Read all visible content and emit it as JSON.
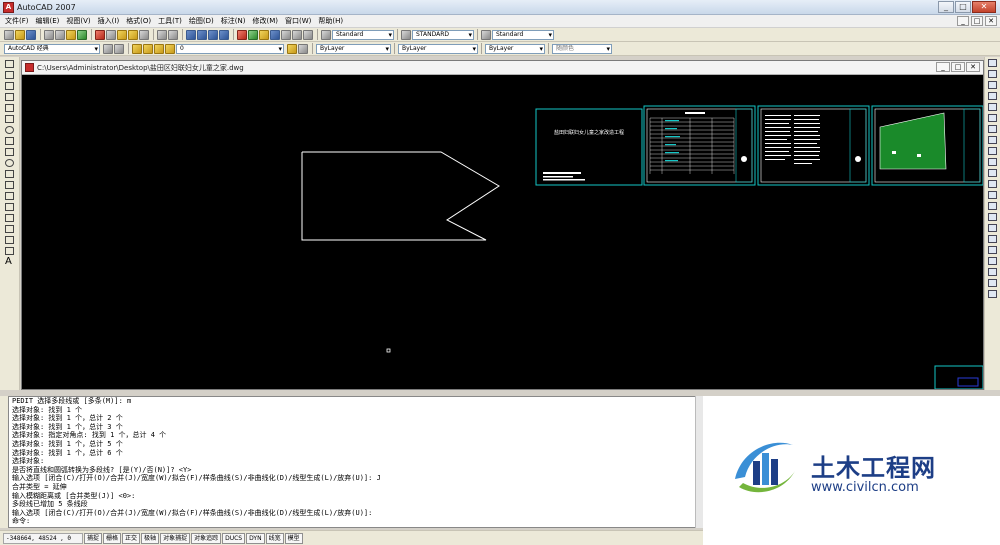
{
  "window": {
    "title": "AutoCAD 2007",
    "controls": [
      "_",
      "□",
      "✕"
    ]
  },
  "menu": {
    "items": [
      "文件(F)",
      "编辑(E)",
      "视图(V)",
      "插入(I)",
      "格式(O)",
      "工具(T)",
      "绘图(D)",
      "标注(N)",
      "修改(M)",
      "窗口(W)",
      "帮助(H)"
    ],
    "doc_controls": [
      "_",
      "□",
      "✕"
    ]
  },
  "toolbar_styles": {
    "text_style": "Standard",
    "dim_style": "STANDARD",
    "table_style": "Standard"
  },
  "toolbar_layers": {
    "workspace": "AutoCAD 经典",
    "layer": "0",
    "color": "ByLayer",
    "linetype": "ByLayer",
    "lineweight": "ByLayer",
    "plotstyle": "随颜色"
  },
  "drawing": {
    "path": "C:\\Users\\Administrator\\Desktop\\盐田区妇联妇女儿童之家.dwg",
    "sheet_title": "盐田妇联妇女儿童之家改造工程",
    "line_color": "#ffffff",
    "frame_color": "#13c6c6"
  },
  "command": {
    "lines": [
      "PEDIT 选择多段线或 [多条(M)]: m",
      "选择对象: 找到 1 个",
      "选择对象: 找到 1 个，总计 2 个",
      "选择对象: 找到 1 个，总计 3 个",
      "选择对象: 指定对角点: 找到 1 个，总计 4 个",
      "选择对象: 找到 1 个，总计 5 个",
      "选择对象: 找到 1 个，总计 6 个",
      "选择对象:",
      "是否将直线和圆弧转换为多段线? [是(Y)/否(N)]? <Y>",
      "输入选项 [闭合(C)/打开(O)/合并(J)/宽度(W)/拟合(F)/样条曲线(S)/非曲线化(D)/线型生成(L)/放弃(U)]: J",
      "合并类型 = 延伸",
      "输入模糊距离或 [合并类型(J)] <0>:",
      "多段线已增加 5 条线段",
      "输入选项 [闭合(C)/打开(O)/合并(J)/宽度(W)/拟合(F)/样条曲线(S)/非曲线化(D)/线型生成(L)/放弃(U)]:",
      "命令:"
    ]
  },
  "status": {
    "coords": "-348664, 48524 , 0",
    "buttons": [
      "捕捉",
      "栅格",
      "正交",
      "极轴",
      "对象捕捉",
      "对象追踪",
      "DUCS",
      "DYN",
      "线宽",
      "模型"
    ]
  },
  "watermark": {
    "title": "土木工程网",
    "url": "www.civilcn.com",
    "colors": {
      "blue": "#1d3e86",
      "green": "#74b53c",
      "sky": "#3a8fd6"
    }
  }
}
